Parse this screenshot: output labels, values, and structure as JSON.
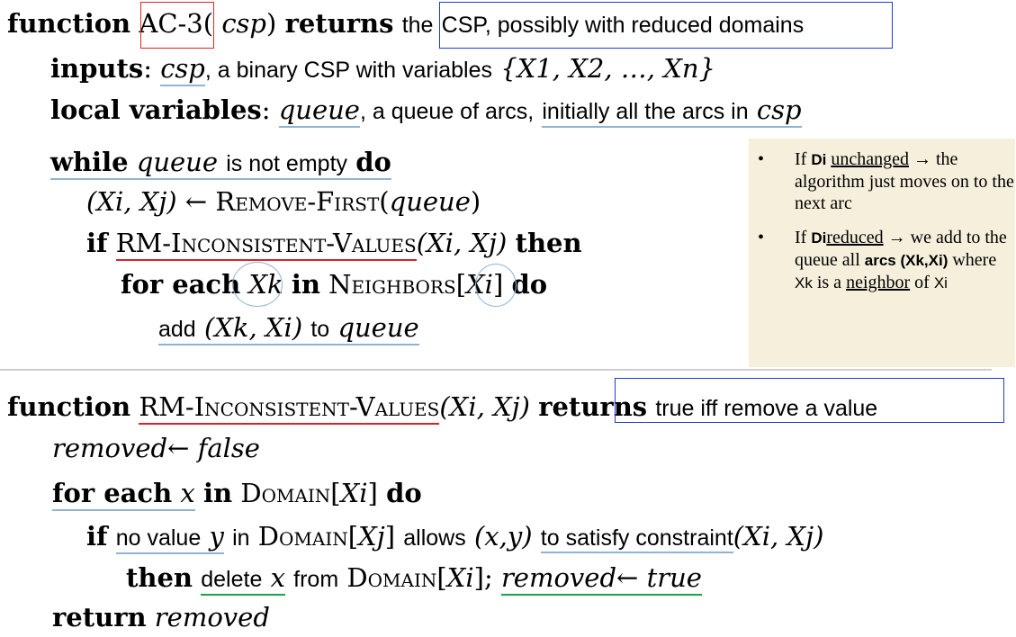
{
  "ac3": {
    "header": {
      "kw_function": "function",
      "name": "AC-3",
      "param_open": "(",
      "param": "csp",
      "param_close": ")",
      "kw_returns": "returns",
      "the": "the",
      "returns_desc": "CSP, possibly with reduced domains"
    },
    "inputs": {
      "label": "inputs",
      "colon": ":",
      "var": "csp",
      "text": ", a binary CSP with variables",
      "set": "{X1, X2, …, Xn}"
    },
    "local": {
      "label": "local variables",
      "colon": ":",
      "var": "queue",
      "text_mid": ", a queue of arcs,",
      "text_ul": "initially all the arcs in",
      "var2": "csp"
    },
    "while_line": {
      "kw_while": "while",
      "var": "queue",
      "text": "is not empty",
      "kw_do": "do"
    },
    "remove_line": {
      "lhs": "(Xi, Xj)",
      "arrow": "←",
      "func": "Remove-First",
      "arg": "queue"
    },
    "if_line": {
      "kw_if": "if",
      "func": "RM-Inconsistent-Values",
      "args": "(Xi, Xj)",
      "kw_then": "then"
    },
    "for_line": {
      "kw_for_each": "for each",
      "var": "Xk",
      "kw_in": "in",
      "func": "Neighbors",
      "index": "Xi",
      "kw_do": "do"
    },
    "add_line": {
      "kw_add": "add",
      "pair": "(Xk, Xi)",
      "kw_to": "to",
      "var": "queue"
    }
  },
  "note": {
    "bullets": [
      {
        "if": "If",
        "var": "Di",
        "cond": "unchanged",
        "arrow": "→",
        "text": "the algorithm just moves on to the next arc"
      },
      {
        "if": "If",
        "var": "Di",
        "cond": "reduced",
        "arrow": "→",
        "text1": "we add to the queue all",
        "arcs": "arcs (Xk,Xi)",
        "text2": "where",
        "xk": "Xk",
        "text3": "is a",
        "neighbor": "neighbor",
        "text4": "of",
        "xi": "Xi"
      }
    ]
  },
  "rm": {
    "header": {
      "kw_function": "function",
      "name": "RM-Inconsistent-Values",
      "args": "(Xi, Xj)",
      "kw_returns": "returns",
      "returns_desc": "true iff remove a value"
    },
    "init": {
      "var": "removed",
      "arrow": "←",
      "value": "false"
    },
    "for_line": {
      "kw_for_each": "for each",
      "var": "x",
      "kw_in": "in",
      "func": "Domain",
      "index": "Xi",
      "kw_do": "do"
    },
    "if_line": {
      "kw_if": "if",
      "text1": "no value",
      "var": "y",
      "text2": "in",
      "func": "Domain",
      "index": "Xj",
      "text3": "allows",
      "pair": "(x,y)",
      "text4": "to satisfy constraint",
      "args": "(Xi, Xj)"
    },
    "then_line": {
      "kw_then": "then",
      "delete": "delete",
      "var": "x",
      "text": "from",
      "func": "Domain",
      "index": "Xi",
      "semi": ";",
      "removed": "removed",
      "arrow": "←",
      "value": "true"
    },
    "return_line": {
      "kw_return": "return",
      "var": "removed"
    }
  },
  "colors": {
    "underline_blue": "#8fb4d3",
    "underline_red": "#d9232b",
    "underline_green": "#1aa24b",
    "box_red": "#e3241d",
    "box_blue": "#1f3ad6",
    "note_bg": "#f5efdc"
  }
}
